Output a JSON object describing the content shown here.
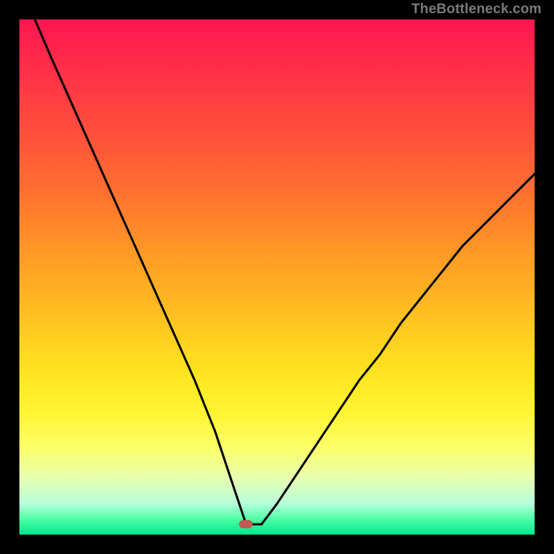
{
  "watermark": "TheBottleneck.com",
  "colors": {
    "frame_bg": "#000000",
    "curve_stroke": "#000000",
    "watermark_text": "#7a7a7a",
    "minpoint_fill": "#c15a52",
    "gradient_stops": [
      "#ff1550",
      "#ff2a4a",
      "#ff4a3e",
      "#ff6e30",
      "#ff9826",
      "#ffbf20",
      "#ffe21f",
      "#fff430",
      "#fcff66",
      "#e7ffb0",
      "#b6ffda",
      "#4dffa6",
      "#00e58b"
    ]
  },
  "chart_data": {
    "type": "line",
    "title": "",
    "xlabel": "",
    "ylabel": "",
    "xlim": [
      0,
      100
    ],
    "ylim": [
      0,
      100
    ],
    "grid": false,
    "legend_position": "none",
    "annotations": [
      {
        "text": "TheBottleneck.com",
        "role": "watermark",
        "position": "top-right"
      }
    ],
    "min_point": {
      "x": 44,
      "y": 2
    },
    "series": [
      {
        "name": "left-branch",
        "x": [
          3,
          6,
          10,
          14,
          18,
          22,
          26,
          30,
          34,
          38,
          41,
          43,
          44
        ],
        "y": [
          100,
          93,
          84,
          75,
          66,
          57,
          48,
          39,
          30,
          20,
          11,
          5,
          2
        ]
      },
      {
        "name": "floor",
        "x": [
          44,
          47
        ],
        "y": [
          2,
          2
        ]
      },
      {
        "name": "right-branch",
        "x": [
          47,
          50,
          54,
          58,
          62,
          66,
          70,
          74,
          78,
          82,
          86,
          90,
          94,
          98,
          100
        ],
        "y": [
          2,
          6,
          12,
          18,
          24,
          30,
          35,
          41,
          46,
          51,
          56,
          60,
          64,
          68,
          70
        ]
      }
    ]
  }
}
